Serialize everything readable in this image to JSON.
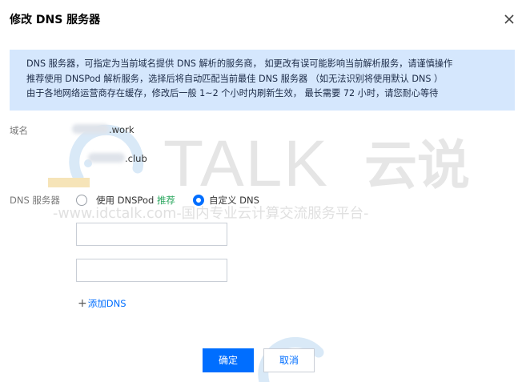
{
  "dialog": {
    "title": "修改 DNS 服务器",
    "notice_lines": [
      "DNS 服务器，可指定为当前域名提供 DNS 解析的服务商， 如更改有误可能影响当前解析服务，请谨慎操作",
      "推荐使用 DNSPod 解析服务，选择后将自动匹配当前最佳 DNS 服务器 （如无法识别将使用默认 DNS ）",
      "由于各地网络运营商存在缓存，修改后一般 1~2 个小时内刷新生效， 最长需要 72 小时，请您耐心等待"
    ],
    "domain_label": "域名",
    "domains": [
      ".work",
      ".club"
    ],
    "dns_label": "DNS 服务器",
    "options": {
      "dnspod": "使用 DNSPod",
      "recommend": "推荐",
      "custom": "自定义 DNS"
    },
    "selected_option": "custom",
    "inputs": [
      {
        "value": "",
        "placeholder": ""
      },
      {
        "value": "",
        "placeholder": ""
      }
    ],
    "add_dns": "添加DNS",
    "confirm": "确定",
    "cancel": "取消"
  },
  "watermark": {
    "brand": "TALK",
    "brand_cn": "云说",
    "url_line": "-www.idctalk.com-国内专业云计算交流服务平台-"
  },
  "colors": {
    "accent": "#006eff",
    "notice_bg": "#d5e7fd",
    "recommend": "#29a65d",
    "watermark_blue": "#d9e9f7",
    "watermark_gray": "#e2e2e2",
    "watermark_yellow": "#f6e4b8"
  },
  "icons": [
    "close-icon",
    "radio-unchecked-icon",
    "radio-checked-icon",
    "plus-icon",
    "idctalk-logo-icon"
  ]
}
